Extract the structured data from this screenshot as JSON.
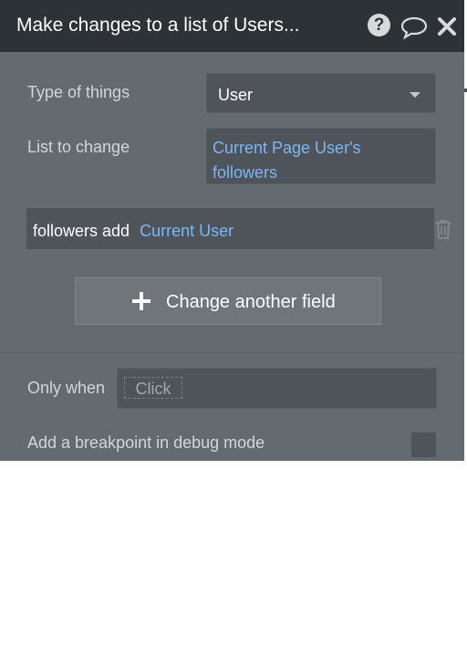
{
  "header": {
    "title": "Make changes to a list of Users...",
    "help_glyph": "?",
    "icons": [
      "help-icon",
      "comment-icon",
      "close-icon"
    ]
  },
  "type_of_things": {
    "label": "Type of things",
    "value": "User"
  },
  "list_to_change": {
    "label": "List to change",
    "line1": "Current Page User's",
    "line2": "followers"
  },
  "change": {
    "field_op": "followers add",
    "value": "Current User"
  },
  "add_field_button": {
    "label": "Change another field"
  },
  "only_when": {
    "label": "Only when",
    "placeholder": "Click"
  },
  "breakpoint": {
    "label": "Add a breakpoint in debug mode",
    "checked": false
  },
  "colors": {
    "panel": "#636b71",
    "header": "#2d3236",
    "field": "#4e5459",
    "expression": "#7cb6f5"
  }
}
